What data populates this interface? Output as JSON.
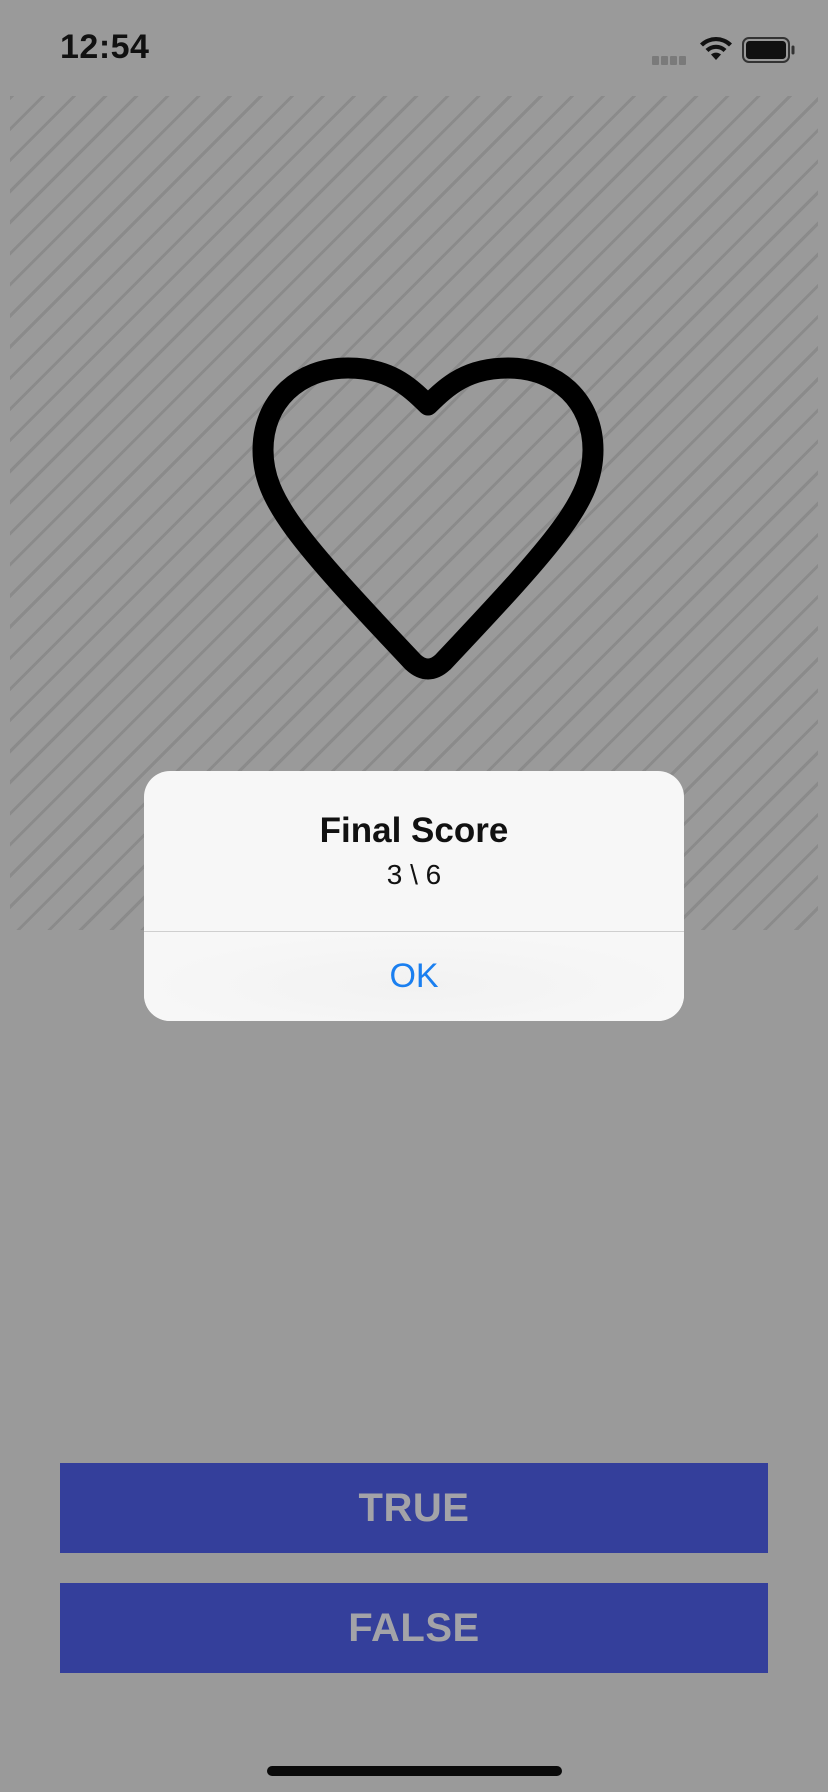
{
  "status_bar": {
    "time": "12:54",
    "icons": [
      "cellular-signal-icon",
      "wifi-icon",
      "battery-icon"
    ]
  },
  "question_image": {
    "icon": "heart-outline-icon"
  },
  "alert": {
    "title": "Final Score",
    "message": "3 \\ 6",
    "ok_label": "OK"
  },
  "answers": {
    "true_label": "TRUE",
    "false_label": "FALSE"
  },
  "colors": {
    "background_dim": "#9a9a9a",
    "button_fill": "#343f9b",
    "button_text": "#a3a3a8",
    "alert_background": "#f7f7f7",
    "alert_action": "#1a7ff0"
  }
}
